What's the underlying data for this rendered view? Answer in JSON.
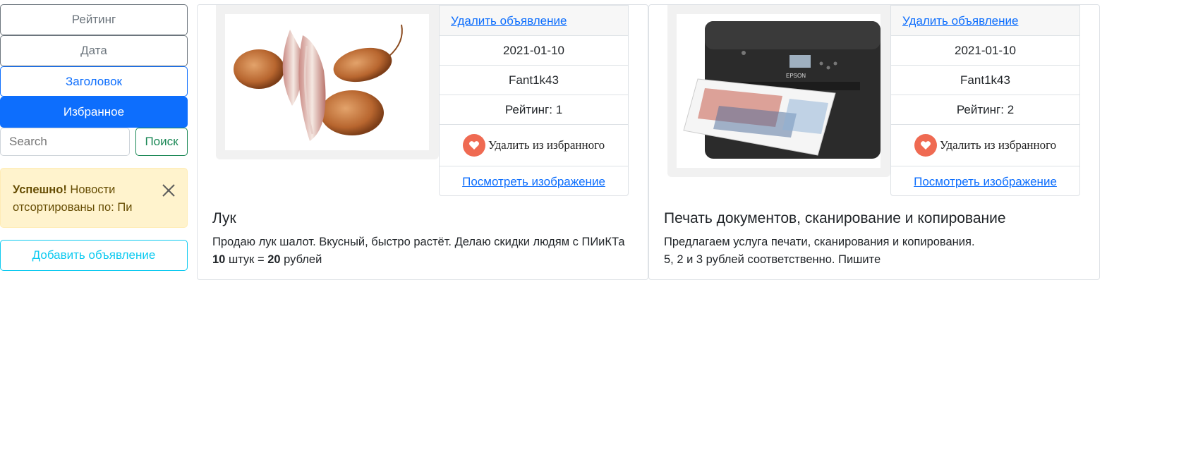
{
  "sidebar": {
    "sort_rating": "Рейтинг",
    "sort_date": "Дата",
    "sort_title": "Заголовок",
    "sort_favorites": "Избранное",
    "search_placeholder": "Search",
    "search_button": "Поиск",
    "alert_strong": "Успешно!",
    "alert_text": " Новости отсортированы по: Пи",
    "add_button": "Добавить объявление"
  },
  "cards": [
    {
      "delete_link": "Удалить объявление",
      "date": "2021-01-10",
      "author": "Fant1k43",
      "rating": "Рейтинг: 1",
      "favorite_label": "Удалить из избранного",
      "view_image_link": "Посмотреть изображение",
      "title": "Лук",
      "text_line1": "Продаю лук шалот. Вкусный, быстро растёт. Делаю скидки людям с ПИиКТа",
      "qty": "10",
      "text_mid": " штук = ",
      "price": "20",
      "text_end": " рублей"
    },
    {
      "delete_link": "Удалить объявление",
      "date": "2021-01-10",
      "author": "Fant1k43",
      "rating": "Рейтинг: 2",
      "favorite_label": "Удалить из избранного",
      "view_image_link": "Посмотреть изображение",
      "title": "Печать документов, сканирование и копирование",
      "text_line1": "Предлагаем услуга печати, сканирования и копирования.",
      "text_line2": "5, 2 и 3 рублей соответственно. Пишите",
      "printer_brand": "EPSON"
    }
  ],
  "colors": {
    "primary": "#0d6efd",
    "success": "#198754",
    "info": "#0dcaf0",
    "warning_bg": "#fff3cd",
    "heart": "#ef6a52"
  }
}
